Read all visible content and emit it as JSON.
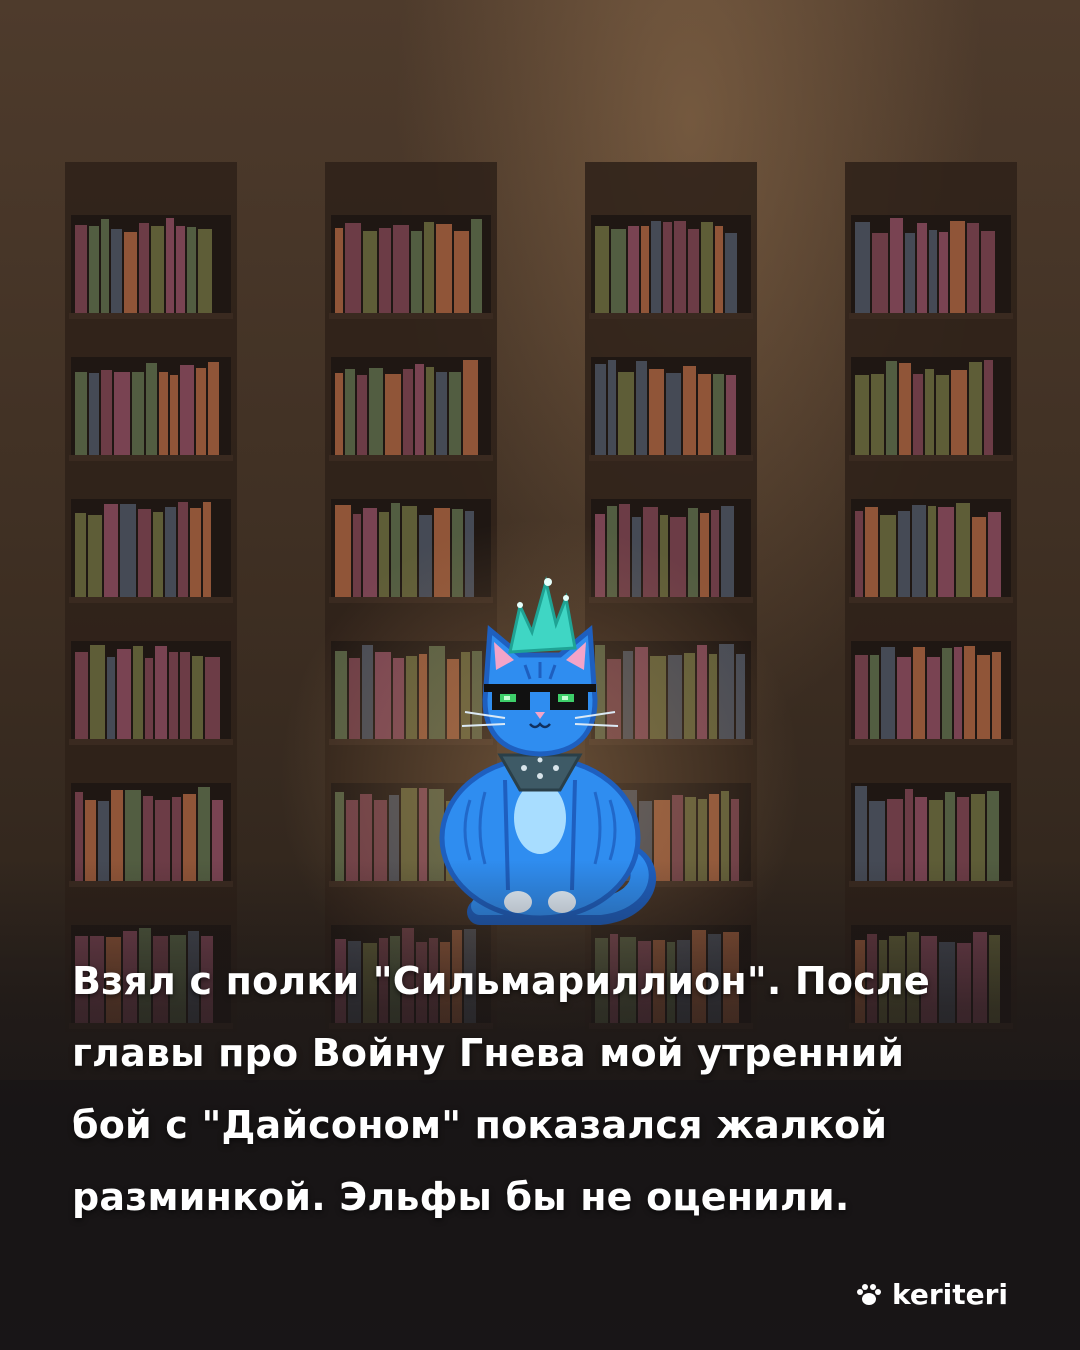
{
  "caption": {
    "line1": "Взял с полки \"Сильмариллион\". После",
    "line2": "главы про Войну Гнева мой утренний",
    "line3": "бой с \"Дайсоном\" показался жалкой",
    "line4": "разминкой. Эльфы бы не оценили."
  },
  "brand": {
    "name": "keriteri",
    "icon": "paw-icon"
  },
  "colors": {
    "book_palette": [
      "#7a4350",
      "#6a6a3e",
      "#a4603f",
      "#5c6a4a",
      "#4c5462",
      "#8a4b5e"
    ],
    "cat_body": "#2f8df0",
    "cat_mohawk": "#3fd6c4"
  },
  "illustration": {
    "subject": "blue cat with mohawk and sunglasses sitting in front of bookshelves",
    "bookcase_count": 4,
    "shelves_per_bookcase": 6
  }
}
